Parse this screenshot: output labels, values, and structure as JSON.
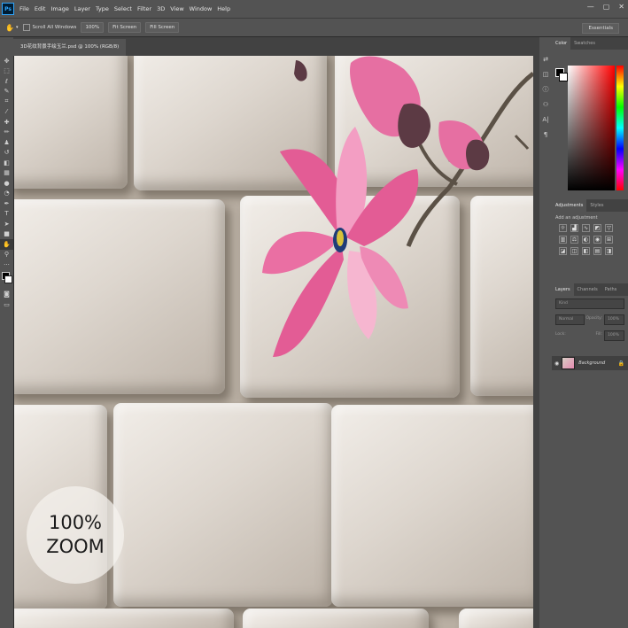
{
  "app": {
    "logo": "Ps"
  },
  "menu": [
    "File",
    "Edit",
    "Image",
    "Layer",
    "Type",
    "Select",
    "Filter",
    "3D",
    "View",
    "Window",
    "Help"
  ],
  "window_controls": {
    "minimize": "—",
    "maximize": "▢",
    "close": "✕"
  },
  "options": {
    "scroll_all_label": "Scroll All Windows",
    "zoom_100_label": "100%",
    "fit_screen_label": "Fit Screen",
    "fill_screen_label": "Fill Screen",
    "workspace": "Essentials"
  },
  "document": {
    "tab_title": "3D花纹背景手绘玉兰.psd @ 100% (RGB/8)"
  },
  "zoom_badge": {
    "line1": "100%",
    "line2": "ZOOM"
  },
  "panels": {
    "color_tabs": [
      "Color",
      "Swatches"
    ],
    "adjust_tabs": [
      "Adjustments",
      "Styles"
    ],
    "adjust_label": "Add an adjustment",
    "layers_tabs": [
      "Layers",
      "Channels",
      "Paths"
    ],
    "kind_placeholder": "Kind",
    "blend_mode": "Normal",
    "opacity_label": "Opacity:",
    "opacity_value": "100%",
    "lock_label": "Lock:",
    "fill_label": "Fill:",
    "fill_value": "100%",
    "layer_name": "Background"
  },
  "colors": {
    "accent": "#31a8ff",
    "flower_pink": "#e35c95",
    "ui_bg": "#535353"
  },
  "icons": [
    "move-icon",
    "marquee-icon",
    "lasso-icon",
    "quick-select-icon",
    "crop-icon",
    "eyedropper-icon",
    "healing-icon",
    "brush-icon",
    "stamp-icon",
    "history-brush-icon",
    "eraser-icon",
    "gradient-icon",
    "blur-icon",
    "dodge-icon",
    "pen-icon",
    "type-icon",
    "path-select-icon",
    "rectangle-icon",
    "hand-icon",
    "zoom-icon"
  ]
}
